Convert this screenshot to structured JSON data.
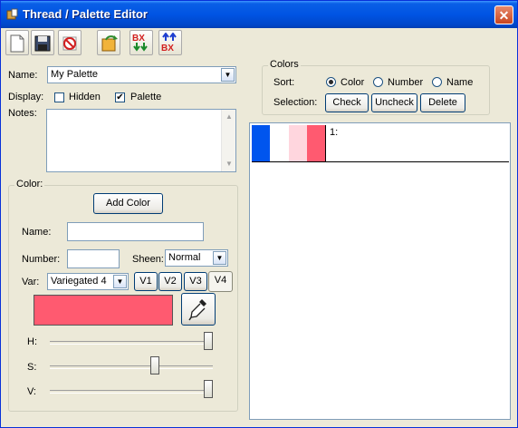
{
  "window": {
    "title": "Thread / Palette Editor"
  },
  "toolbar": {
    "bx_down_text": "BX",
    "bx_up_text": "BX"
  },
  "form": {
    "name_label": "Name:",
    "name_value": "My Palette",
    "display_label": "Display:",
    "hidden_label": "Hidden",
    "hidden_checked": false,
    "palette_label": "Palette",
    "palette_checked": true,
    "notes_label": "Notes:"
  },
  "colors_group": {
    "title": "Colors",
    "sort_label": "Sort:",
    "sort_options": [
      "Color",
      "Number",
      "Name"
    ],
    "sort_selected": "Color",
    "selection_label": "Selection:",
    "check_label": "Check",
    "uncheck_label": "Uncheck",
    "delete_label": "Delete"
  },
  "color_group": {
    "title": "Color:",
    "add_color_label": "Add Color",
    "name_label": "Name:",
    "name_value": "",
    "number_label": "Number:",
    "number_value": "",
    "sheen_label": "Sheen:",
    "sheen_value": "Normal",
    "var_label": "Var:",
    "var_value": "Variegated 4",
    "v_buttons": [
      "V1",
      "V2",
      "V3",
      "V4"
    ],
    "v_selected": "V4",
    "current_color": "#FF5A70",
    "h_label": "H:",
    "s_label": "S:",
    "v_label": "V:",
    "h_value": 1.0,
    "s_value": 0.65,
    "v_value": 1.0
  },
  "palette_list": {
    "items": [
      {
        "label": "1:",
        "swatches": [
          "#0055EE",
          "#FFFFFF",
          "#FFD6DE",
          "#FF5A70"
        ]
      }
    ]
  }
}
